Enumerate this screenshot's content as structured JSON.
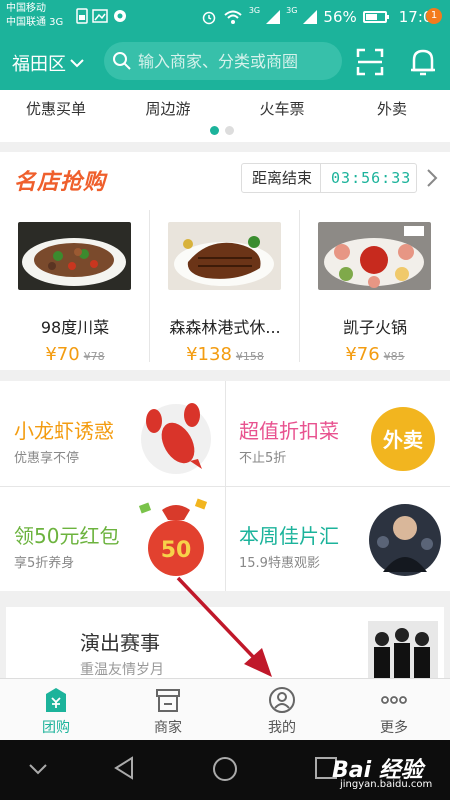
{
  "status_bar": {
    "carrier_1": "中国移动",
    "carrier_2": "中国联通 3G",
    "signal_1": "3G",
    "signal_2": "3G",
    "battery": "56%",
    "time": "17:03"
  },
  "header": {
    "city": "福田区",
    "search_placeholder": "输入商家、分类或商圈",
    "notification_count": "1"
  },
  "categories": [
    "优惠买单",
    "周边游",
    "火车票",
    "外卖"
  ],
  "famous": {
    "title": "名店抢购",
    "countdown_label": "距离结束",
    "countdown_time": "03:56:33",
    "stores": [
      {
        "name": "98度川菜",
        "price": "¥70",
        "old_price": "¥78"
      },
      {
        "name": "森森林港式休...",
        "price": "¥138",
        "old_price": "¥158"
      },
      {
        "name": "凯子火锅",
        "price": "¥76",
        "old_price": "¥85"
      }
    ]
  },
  "promos": [
    {
      "title": "小龙虾诱惑",
      "subtitle": "优惠享不停",
      "color": "#f39c11"
    },
    {
      "title": "超值折扣菜",
      "subtitle": "不止5折",
      "color": "#e8528f",
      "badge": "外卖"
    },
    {
      "title": "领50元红包",
      "subtitle": "享5折养身",
      "color": "#6cb33e",
      "badge": "50"
    },
    {
      "title": "本周佳片汇",
      "subtitle": "15.9特惠观影",
      "color": "#1cb39b"
    }
  ],
  "show": {
    "title": "演出赛事",
    "subtitle": "重温友情岁月"
  },
  "tabs": [
    {
      "label": "团购",
      "icon": "groupbuy-icon",
      "active": true
    },
    {
      "label": "商家",
      "icon": "store-icon",
      "active": false
    },
    {
      "label": "我的",
      "icon": "user-icon",
      "active": false
    },
    {
      "label": "更多",
      "icon": "more-icon",
      "active": false
    }
  ],
  "watermark": {
    "brand": "Bai 经验",
    "url": "jingyan.baidu.com"
  },
  "colors": {
    "brand": "#1cb39b",
    "price": "#f39c11",
    "famous_title": "#ef5f2c",
    "annotation_arrow": "#c0182a"
  }
}
